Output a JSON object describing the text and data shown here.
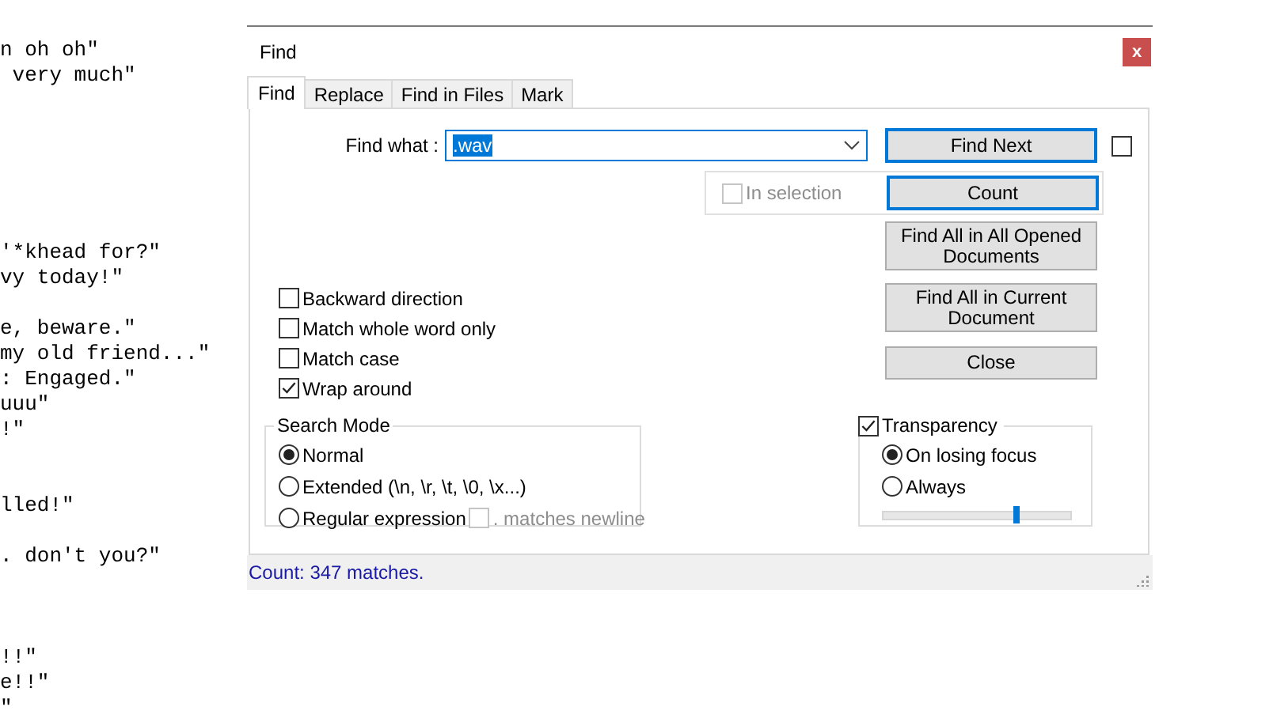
{
  "editor": {
    "lines": [
      {
        "kind": "text",
        "text": "n oh oh\""
      },
      {
        "kind": "text",
        "text": " very much\""
      },
      {
        "kind": "blank"
      },
      {
        "kind": "blank"
      },
      {
        "kind": "blank"
      },
      {
        "kind": "blank"
      },
      {
        "kind": "blank"
      },
      {
        "kind": "blank"
      },
      {
        "kind": "text",
        "text": "'*khead for?\""
      },
      {
        "kind": "text",
        "text": "vy today!\""
      },
      {
        "kind": "blank"
      },
      {
        "kind": "text",
        "text": "e, beware.\""
      },
      {
        "kind": "text",
        "text": "my old friend...\""
      },
      {
        "kind": "text",
        "text": ": Engaged.\""
      },
      {
        "kind": "text",
        "text": "uuu\""
      },
      {
        "kind": "text",
        "text": "!\""
      },
      {
        "kind": "blank"
      },
      {
        "kind": "blank"
      },
      {
        "kind": "text",
        "text": "lled!\""
      },
      {
        "kind": "blank"
      },
      {
        "kind": "text",
        "text": ". don't you?\""
      },
      {
        "kind": "blank"
      },
      {
        "kind": "blank"
      },
      {
        "kind": "blank"
      },
      {
        "kind": "text",
        "text": "!!\""
      },
      {
        "kind": "text",
        "text": "e!!\""
      },
      {
        "kind": "text",
        "text": "\""
      }
    ]
  },
  "dialog": {
    "title": "Find",
    "close_label": "x",
    "tabs": [
      {
        "label": "Find",
        "selected": true
      },
      {
        "label": "Replace",
        "selected": false
      },
      {
        "label": "Find in Files",
        "selected": false
      },
      {
        "label": "Mark",
        "selected": false
      }
    ],
    "find_what": {
      "label": "Find what :",
      "value": ".wav",
      "text_selected": true
    },
    "side_checkbox": {
      "checked": false
    },
    "in_selection": {
      "label": "In selection",
      "checked": false,
      "disabled": true
    },
    "buttons": [
      {
        "label": "Find Next",
        "highlighted": true
      },
      {
        "label": "Count",
        "highlighted": true
      },
      {
        "label": "Find All in All Opened Documents",
        "highlighted": false
      },
      {
        "label": "Find All in Current Document",
        "highlighted": false
      },
      {
        "label": "Close",
        "highlighted": false
      }
    ],
    "options": [
      {
        "label": "Backward direction",
        "checked": false
      },
      {
        "label": "Match whole word only",
        "checked": false
      },
      {
        "label": "Match case",
        "checked": false
      },
      {
        "label": "Wrap around",
        "checked": true
      }
    ],
    "search_mode": {
      "title": "Search Mode",
      "modes": [
        {
          "label": "Normal",
          "selected": true
        },
        {
          "label": "Extended (\\n, \\r, \\t, \\0, \\x...)",
          "selected": false
        },
        {
          "label": "Regular expression",
          "selected": false
        }
      ],
      "matches_newline": {
        "label": ". matches newline",
        "checked": false,
        "disabled": true
      }
    },
    "transparency": {
      "label": "Transparency",
      "checked": true,
      "modes": [
        {
          "label": "On losing focus",
          "selected": true
        },
        {
          "label": "Always",
          "selected": false
        }
      ],
      "level": 0.71
    },
    "status": "Count: 347 matches."
  }
}
